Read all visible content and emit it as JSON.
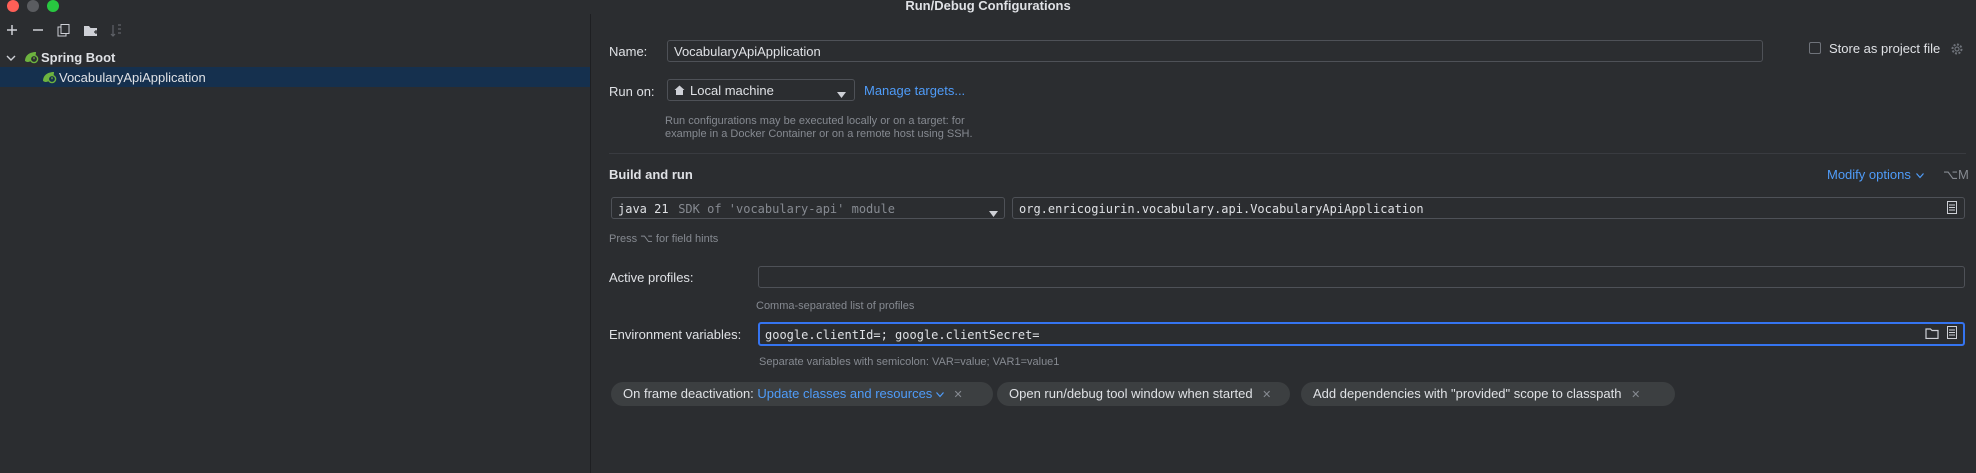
{
  "window": {
    "title": "Run/Debug Configurations"
  },
  "toolbar": {
    "add_icon": "plus-icon",
    "remove_icon": "minus-icon",
    "copy_icon": "copy-icon",
    "folder_icon": "new-folder-icon",
    "sort_icon": "sort-icon"
  },
  "tree": {
    "group": {
      "label": "Spring Boot",
      "icon": "spring-boot-icon"
    },
    "items": [
      {
        "label": "VocabularyApiApplication",
        "selected": true,
        "icon": "spring-boot-icon"
      }
    ]
  },
  "form": {
    "name_label": "Name:",
    "name_value": "VocabularyApiApplication",
    "store_label": "Store as project file",
    "store_checked": false,
    "run_on_label": "Run on:",
    "run_on_value": "Local machine",
    "manage_targets": "Manage targets...",
    "run_on_hint_1": "Run configurations may be executed locally or on a target: for",
    "run_on_hint_2": "example in a Docker Container or on a remote host using SSH.",
    "build_run_title": "Build and run",
    "modify_options": "Modify options",
    "modify_shortcut": "⌥M",
    "jdk_version": "java 21",
    "jdk_desc": "SDK of 'vocabulary-api' module",
    "main_class": "org.enricogiurin.vocabulary.api.VocabularyApiApplication",
    "field_hint": "Press ⌥ for field hints",
    "profiles_label": "Active profiles:",
    "profiles_value": "",
    "profiles_hint": "Comma-separated list of profiles",
    "env_label": "Environment variables:",
    "env_value": "google.clientId=; google.clientSecret=",
    "env_hint": "Separate variables with semicolon: VAR=value; VAR1=value1"
  },
  "chips": {
    "frame_label": "On frame deactivation:",
    "frame_value": "Update classes and resources",
    "open_tool": "Open run/debug tool window when started",
    "add_deps": "Add dependencies with \"provided\" scope to classpath"
  },
  "colors": {
    "background": "#2b2d30",
    "selection": "#15304e",
    "link": "#4f9cf9",
    "focus": "#3574f0",
    "spring_green": "#6db33f"
  }
}
